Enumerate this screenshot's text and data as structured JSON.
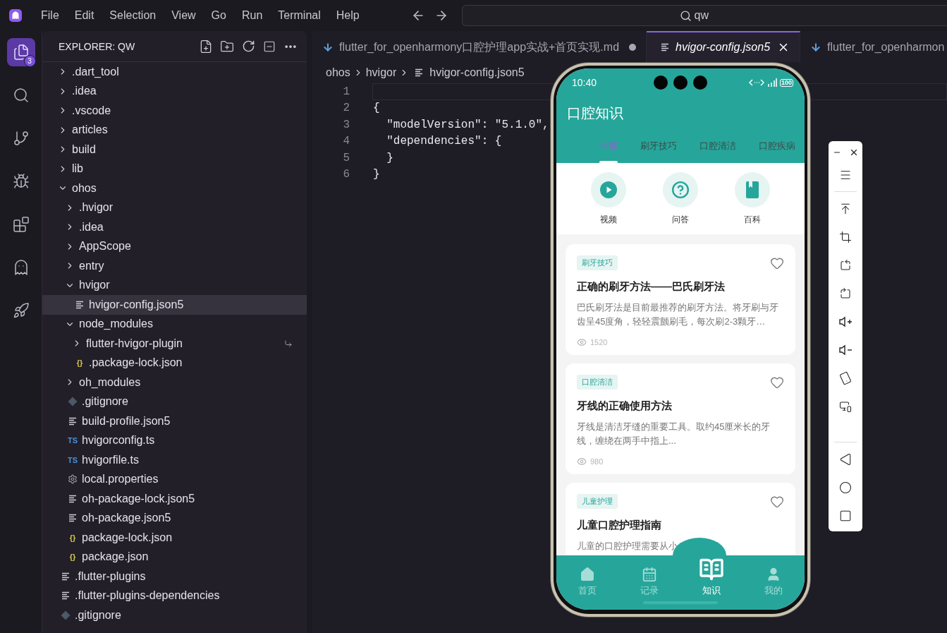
{
  "menu": [
    "File",
    "Edit",
    "Selection",
    "View",
    "Go",
    "Run",
    "Terminal",
    "Help"
  ],
  "search": {
    "value": "qw"
  },
  "activity_bar": [
    {
      "kind": "files",
      "selected": true,
      "badge": "3"
    },
    {
      "kind": "search",
      "selected": false
    },
    {
      "kind": "source",
      "selected": false
    },
    {
      "kind": "debug",
      "selected": false
    },
    {
      "kind": "extensions",
      "selected": false
    },
    {
      "kind": "ghost",
      "selected": false
    },
    {
      "kind": "rocket",
      "selected": false
    }
  ],
  "explorer": {
    "title": "EXPLORER: QW",
    "tree": [
      {
        "name": ".dart_tool",
        "kind": "folder",
        "expanded": false,
        "selected": false
      },
      {
        "name": ".idea",
        "kind": "folder",
        "expanded": false,
        "selected": false
      },
      {
        "name": ".vscode",
        "kind": "folder",
        "expanded": false,
        "selected": false
      },
      {
        "name": "articles",
        "kind": "folder",
        "expanded": false,
        "selected": false
      },
      {
        "name": "build",
        "kind": "folder",
        "expanded": false,
        "selected": false
      },
      {
        "name": "lib",
        "kind": "folder",
        "expanded": false,
        "selected": false
      },
      {
        "name": "ohos",
        "kind": "folder",
        "expanded": true,
        "selected": false,
        "children": [
          {
            "name": ".hvigor",
            "kind": "folder",
            "expanded": false,
            "selected": false
          },
          {
            "name": ".idea",
            "kind": "folder",
            "expanded": false,
            "selected": false
          },
          {
            "name": "AppScope",
            "kind": "folder",
            "expanded": false,
            "selected": false
          },
          {
            "name": "entry",
            "kind": "folder",
            "expanded": false,
            "selected": false
          },
          {
            "name": "hvigor",
            "kind": "folder",
            "expanded": true,
            "selected": false,
            "children": [
              {
                "name": "hvigor-config.json5",
                "kind": "lines",
                "selected": true
              }
            ]
          },
          {
            "name": "node_modules",
            "kind": "folder",
            "expanded": true,
            "selected": false,
            "children": [
              {
                "name": "flutter-hvigor-plugin",
                "kind": "folder_link",
                "expanded": false,
                "selected": false
              },
              {
                "name": ".package-lock.json",
                "kind": "braces",
                "icon_label": "{}",
                "selected": false
              }
            ]
          },
          {
            "name": "oh_modules",
            "kind": "folder",
            "expanded": false,
            "selected": false
          },
          {
            "name": ".gitignore",
            "kind": "git",
            "selected": false
          },
          {
            "name": "build-profile.json5",
            "kind": "lines",
            "selected": false
          },
          {
            "name": "hvigorconfig.ts",
            "kind": "ts",
            "icon_label": "TS",
            "selected": false
          },
          {
            "name": "hvigorfile.ts",
            "kind": "ts",
            "icon_label": "TS",
            "selected": false
          },
          {
            "name": "local.properties",
            "kind": "gear",
            "selected": false
          },
          {
            "name": "oh-package-lock.json5",
            "kind": "lines",
            "selected": false
          },
          {
            "name": "oh-package.json5",
            "kind": "lines",
            "selected": false
          },
          {
            "name": "package-lock.json",
            "kind": "braces",
            "icon_label": "{}",
            "selected": false
          },
          {
            "name": "package.json",
            "kind": "braces",
            "icon_label": "{}",
            "selected": false
          }
        ]
      },
      {
        "name": ".flutter-plugins",
        "kind": "lines",
        "selected": false
      },
      {
        "name": ".flutter-plugins-dependencies",
        "kind": "lines",
        "selected": false
      },
      {
        "name": ".gitignore",
        "kind": "git",
        "selected": false
      }
    ]
  },
  "editor": {
    "tabs": [
      {
        "label": "flutter_for_openharmony口腔护理app实战+首页实现.md",
        "kind": "markdown",
        "selected": false,
        "dirty": true
      },
      {
        "label": "hvigor-config.json5",
        "kind": "lines",
        "selected": true,
        "dirty": false
      },
      {
        "label": "flutter_for_openharmon",
        "kind": "markdown",
        "selected": false,
        "dirty": false
      }
    ],
    "breadcrumbs": [
      "ohos",
      "hvigor",
      "hvigor-config.json5"
    ],
    "lines": [
      {
        "number": "1",
        "current": true
      },
      {
        "number": "2",
        "text": "{",
        "current": false
      },
      {
        "number": "3",
        "text": "  \"modelVersion\": \"5.1.0\",",
        "current": false
      },
      {
        "number": "4",
        "text": "  \"dependencies\": {",
        "current": false
      },
      {
        "number": "5",
        "text": "  }",
        "current": false
      },
      {
        "number": "6",
        "text": "}",
        "current": false
      }
    ]
  },
  "phone": {
    "status": {
      "time": "10:40",
      "battery": "100"
    },
    "title": "口腔知识",
    "tabs": [
      {
        "label": "全部",
        "selected": true
      },
      {
        "label": "刷牙技巧",
        "selected": false
      },
      {
        "label": "口腔清洁",
        "selected": false
      },
      {
        "label": "口腔疾病",
        "selected": false
      }
    ],
    "shortcuts": [
      {
        "kind": "video",
        "label": "视频"
      },
      {
        "kind": "qa",
        "label": "问答"
      },
      {
        "kind": "book",
        "label": "百科"
      }
    ],
    "articles": [
      {
        "tag": "刷牙技巧",
        "title": "正确的刷牙方法——巴氏刷牙法",
        "description": "巴氏刷牙法是目前最推荐的刷牙方法。将牙刷与牙齿呈45度角，轻轻震颤刷毛，每次刷2-3颗牙…",
        "views": "1520",
        "favorite": false
      },
      {
        "tag": "口腔清洁",
        "title": "牙线的正确使用方法",
        "description": "牙线是清洁牙缝的重要工具。取约45厘米长的牙线，缠绕在两手中指上...",
        "views": "980",
        "favorite": false
      },
      {
        "tag": "儿童护理",
        "title": "儿童口腔护理指南",
        "description": "儿童的口腔护理需要从小",
        "favorite": false
      }
    ],
    "nav": [
      {
        "kind": "home",
        "label": "首页",
        "selected": false
      },
      {
        "kind": "record",
        "label": "记录",
        "selected": false
      },
      {
        "kind": "knowledge",
        "label": "知识",
        "selected": true
      },
      {
        "kind": "me",
        "label": "我的",
        "selected": false
      }
    ]
  },
  "emulator_toolbar": [
    {
      "kind": "minimize"
    },
    {
      "kind": "close"
    },
    {
      "kind": "menu"
    },
    {
      "kind": "top"
    },
    {
      "kind": "crop"
    },
    {
      "kind": "rotate_left"
    },
    {
      "kind": "rotate_right"
    },
    {
      "kind": "volume_up"
    },
    {
      "kind": "volume_down"
    },
    {
      "kind": "shake"
    },
    {
      "kind": "devices"
    },
    {
      "kind": "back"
    },
    {
      "kind": "home"
    },
    {
      "kind": "recents"
    }
  ]
}
